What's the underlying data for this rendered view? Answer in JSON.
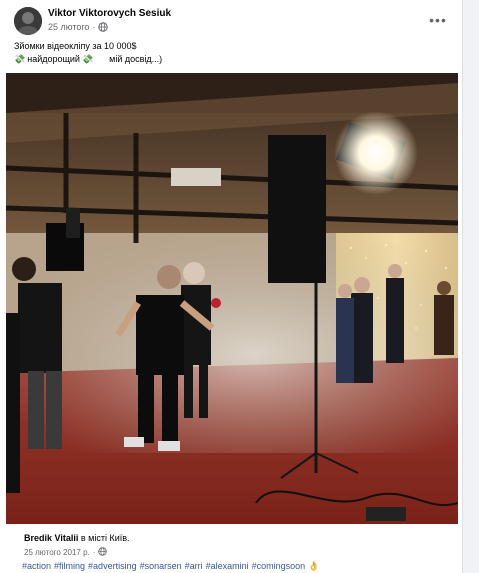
{
  "post": {
    "author": "Viktor Viktorovych Sesiuk",
    "date": "25 лютого",
    "separator": "·",
    "text_line1": "Зйомки відеокліпу за 10 000$",
    "money_emoji": "💸",
    "text_line2a": "найдорощий",
    "text_line2b": "мій досвід...)",
    "more_label": "•••"
  },
  "shared": {
    "author": "Bredik Vitalii",
    "location_text": " в місті Київ.",
    "date": "25 лютого 2017 р.",
    "separator": "·"
  },
  "hashtags": [
    "#action",
    "#filming",
    "#advertising",
    "#sonarsen",
    "#arri",
    "#alexamini",
    "#comingsoon",
    "👌"
  ],
  "icons": {
    "globe": "globe-icon",
    "more": "more-options-icon",
    "money": "money-with-wings-icon"
  },
  "colors": {
    "link": "#385898",
    "meta": "#65676b",
    "background": "#f0f2f5"
  }
}
